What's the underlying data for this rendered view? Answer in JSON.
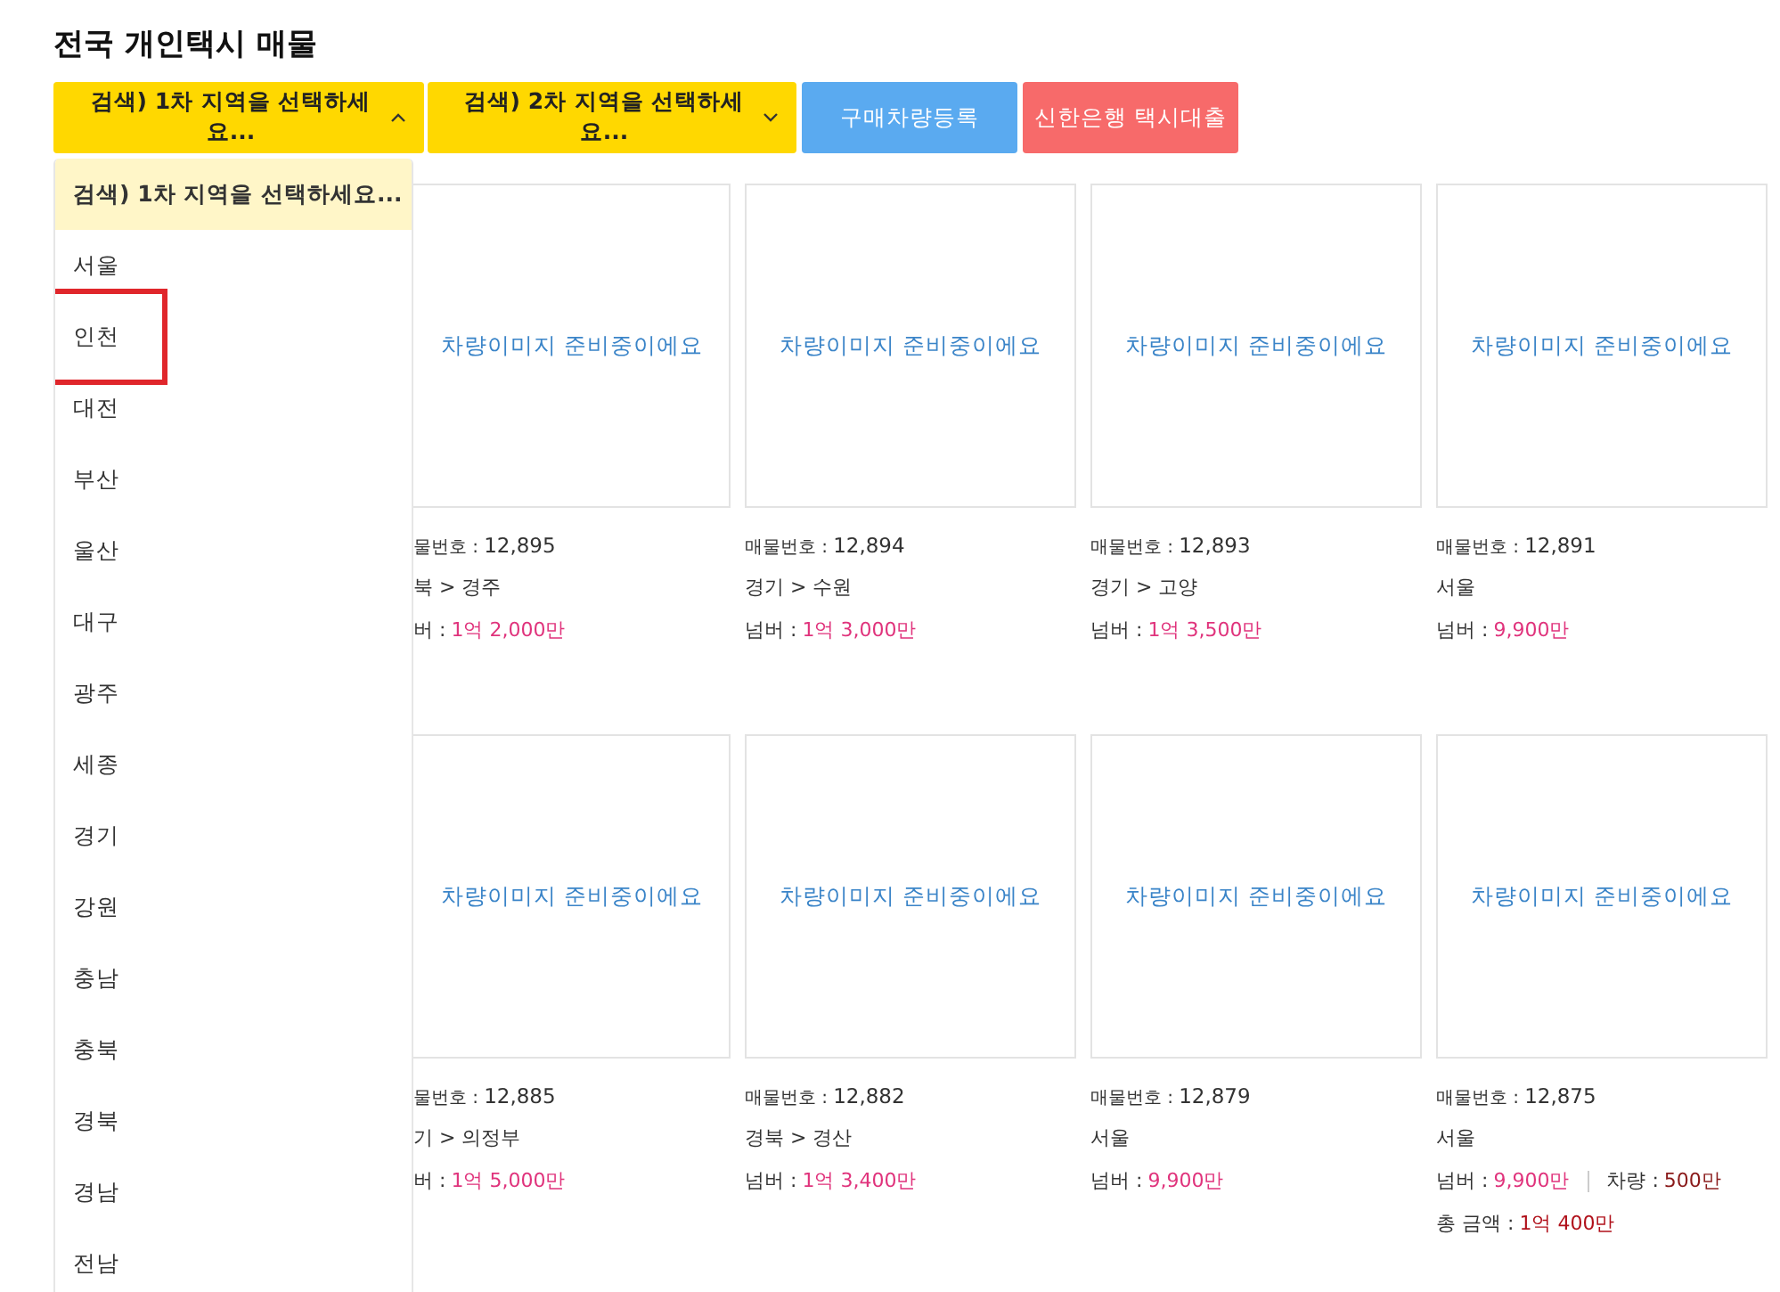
{
  "title": "전국 개인택시 매물",
  "filters": [
    {
      "kind": "select",
      "label": "검색) 1차 지역을 선택하세요...",
      "expanded": true
    },
    {
      "kind": "select",
      "label": "검색) 2차 지역을 선택하세요...",
      "expanded": false
    },
    {
      "kind": "button",
      "label": "구매차량등록",
      "color": "#5aaaf0"
    },
    {
      "kind": "button",
      "label": "신한은행 택시대출",
      "color": "#f76a6a"
    }
  ],
  "dropdown": {
    "items": [
      {
        "label": "검색) 1차 지역을 선택하세요...",
        "selected": true,
        "marked": false
      },
      {
        "label": "서울",
        "selected": false,
        "marked": false
      },
      {
        "label": "인천",
        "selected": false,
        "marked": true
      },
      {
        "label": "대전",
        "selected": false,
        "marked": false
      },
      {
        "label": "부산",
        "selected": false,
        "marked": false
      },
      {
        "label": "울산",
        "selected": false,
        "marked": false
      },
      {
        "label": "대구",
        "selected": false,
        "marked": false
      },
      {
        "label": "광주",
        "selected": false,
        "marked": false
      },
      {
        "label": "세종",
        "selected": false,
        "marked": false
      },
      {
        "label": "경기",
        "selected": false,
        "marked": false
      },
      {
        "label": "강원",
        "selected": false,
        "marked": false
      },
      {
        "label": "충남",
        "selected": false,
        "marked": false
      },
      {
        "label": "충북",
        "selected": false,
        "marked": false
      },
      {
        "label": "경북",
        "selected": false,
        "marked": false
      },
      {
        "label": "경남",
        "selected": false,
        "marked": false
      },
      {
        "label": "전남",
        "selected": false,
        "marked": false
      }
    ]
  },
  "listings": [
    {
      "partly_hidden": true,
      "image_text": "차량이미지 준비중이에요",
      "number_label": "물번호 :",
      "number": "12,895",
      "region": "북 > 경주",
      "price_rows": [
        [
          {
            "label": "버 :",
            "value": "1억 2,000만",
            "kind": "plate"
          }
        ]
      ]
    },
    {
      "partly_hidden": false,
      "image_text": "차량이미지 준비중이에요",
      "number_label": "매물번호 :",
      "number": "12,894",
      "region": "경기 > 수원",
      "price_rows": [
        [
          {
            "label": "넘버 :",
            "value": "1억 3,000만",
            "kind": "plate"
          }
        ]
      ]
    },
    {
      "partly_hidden": false,
      "image_text": "차량이미지 준비중이에요",
      "number_label": "매물번호 :",
      "number": "12,893",
      "region": "경기 > 고양",
      "price_rows": [
        [
          {
            "label": "넘버 :",
            "value": "1억 3,500만",
            "kind": "plate"
          }
        ]
      ]
    },
    {
      "partly_hidden": false,
      "image_text": "차량이미지 준비중이에요",
      "number_label": "매물번호 :",
      "number": "12,891",
      "region": "서울",
      "price_rows": [
        [
          {
            "label": "넘버 :",
            "value": "9,900만",
            "kind": "plate"
          }
        ]
      ]
    },
    {
      "partly_hidden": true,
      "image_text": "차량이미지 준비중이에요",
      "number_label": "물번호 :",
      "number": "12,885",
      "region": "기 > 의정부",
      "price_rows": [
        [
          {
            "label": "버 :",
            "value": "1억 5,000만",
            "kind": "plate"
          }
        ]
      ]
    },
    {
      "partly_hidden": false,
      "image_text": "차량이미지 준비중이에요",
      "number_label": "매물번호 :",
      "number": "12,882",
      "region": "경북 > 경산",
      "price_rows": [
        [
          {
            "label": "넘버 :",
            "value": "1억 3,400만",
            "kind": "plate"
          }
        ]
      ]
    },
    {
      "partly_hidden": false,
      "image_text": "차량이미지 준비중이에요",
      "number_label": "매물번호 :",
      "number": "12,879",
      "region": "서울",
      "price_rows": [
        [
          {
            "label": "넘버 :",
            "value": "9,900만",
            "kind": "plate"
          }
        ]
      ]
    },
    {
      "partly_hidden": false,
      "image_text": "차량이미지 준비중이에요",
      "number_label": "매물번호 :",
      "number": "12,875",
      "region": "서울",
      "price_rows": [
        [
          {
            "label": "넘버 :",
            "value": "9,900만",
            "kind": "plate"
          },
          {
            "label": "차량 :",
            "value": "500만",
            "kind": "vehicle"
          }
        ],
        [
          {
            "label": "총 금액 :",
            "value": "1억 400만",
            "kind": "total"
          }
        ]
      ]
    }
  ]
}
